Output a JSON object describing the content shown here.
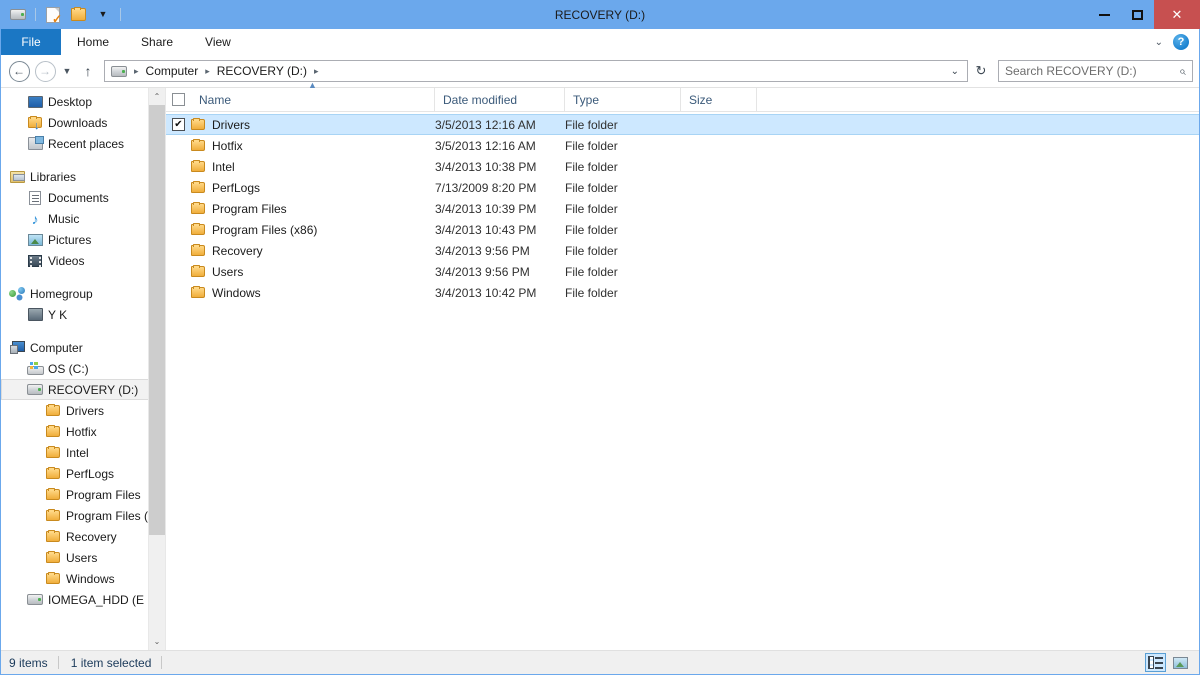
{
  "window": {
    "title": "RECOVERY (D:)",
    "controls": {
      "minimize": "—",
      "maximize": "□",
      "close": "✕"
    },
    "close_color": "#c75050",
    "titlebar_color": "#6ba8ec"
  },
  "quick_access": {
    "items": [
      {
        "name": "drive-icon",
        "label": ""
      },
      {
        "name": "properties-icon",
        "label": ""
      },
      {
        "name": "new-folder-icon",
        "label": ""
      }
    ],
    "dropdown_glyph": "▼"
  },
  "ribbon": {
    "file_tab": "File",
    "tabs": [
      "Home",
      "Share",
      "View"
    ],
    "expand_glyph": "⌄",
    "help_glyph": "?",
    "file_tab_color": "#1b77c4"
  },
  "address_bar": {
    "back_glyph": "←",
    "forward_glyph": "→",
    "recent_glyph": "▼",
    "up_glyph": "↑",
    "breadcrumbs": [
      "Computer",
      "RECOVERY (D:)"
    ],
    "separator": "▸",
    "dropdown_glyph": "⌄",
    "refresh_glyph": "↻"
  },
  "search": {
    "placeholder": "Search RECOVERY (D:)",
    "icon_glyph": "⌕"
  },
  "sidebar": {
    "items": [
      {
        "label": "Desktop",
        "icon": "desktop-icon",
        "indent": 1
      },
      {
        "label": "Downloads",
        "icon": "downloads-folder-icon",
        "indent": 1
      },
      {
        "label": "Recent places",
        "icon": "recent-places-icon",
        "indent": 1
      },
      {
        "label": "Libraries",
        "icon": "libraries-icon",
        "indent": 0
      },
      {
        "label": "Documents",
        "icon": "documents-icon",
        "indent": 1
      },
      {
        "label": "Music",
        "icon": "music-icon",
        "indent": 1
      },
      {
        "label": "Pictures",
        "icon": "pictures-icon",
        "indent": 1
      },
      {
        "label": "Videos",
        "icon": "videos-icon",
        "indent": 1
      },
      {
        "label": "Homegroup",
        "icon": "homegroup-icon",
        "indent": 0
      },
      {
        "label": "Y K",
        "icon": "user-icon",
        "indent": 1
      },
      {
        "label": "Computer",
        "icon": "computer-icon",
        "indent": 0
      },
      {
        "label": "OS (C:)",
        "icon": "os-drive-icon",
        "indent": 1
      },
      {
        "label": "RECOVERY (D:)",
        "icon": "drive-icon",
        "indent": 1,
        "selected": true
      },
      {
        "label": "Drivers",
        "icon": "folder-icon",
        "indent": 2
      },
      {
        "label": "Hotfix",
        "icon": "folder-icon",
        "indent": 2
      },
      {
        "label": "Intel",
        "icon": "folder-icon",
        "indent": 2
      },
      {
        "label": "PerfLogs",
        "icon": "folder-icon",
        "indent": 2
      },
      {
        "label": "Program Files",
        "icon": "folder-icon",
        "indent": 2
      },
      {
        "label": "Program Files (",
        "icon": "folder-icon",
        "indent": 2
      },
      {
        "label": "Recovery",
        "icon": "folder-icon",
        "indent": 2
      },
      {
        "label": "Users",
        "icon": "folder-icon",
        "indent": 2
      },
      {
        "label": "Windows",
        "icon": "folder-icon",
        "indent": 2
      },
      {
        "label": "IOMEGA_HDD (E",
        "icon": "drive-icon",
        "indent": 1
      }
    ],
    "scroll_up_glyph": "⌃",
    "scroll_down_glyph": "⌄"
  },
  "file_list": {
    "columns": [
      {
        "key": "name",
        "label": "Name",
        "sorted": "asc"
      },
      {
        "key": "date",
        "label": "Date modified"
      },
      {
        "key": "type",
        "label": "Type"
      },
      {
        "key": "size",
        "label": "Size"
      }
    ],
    "sort_arrow_glyph": "▲",
    "check_glyph": "✔",
    "rows": [
      {
        "name": "Drivers",
        "date": "3/5/2013 12:16 AM",
        "type": "File folder",
        "size": "",
        "selected": true,
        "checked": true
      },
      {
        "name": "Hotfix",
        "date": "3/5/2013 12:16 AM",
        "type": "File folder",
        "size": "",
        "selected": false,
        "checked": false
      },
      {
        "name": "Intel",
        "date": "3/4/2013 10:38 PM",
        "type": "File folder",
        "size": "",
        "selected": false,
        "checked": false
      },
      {
        "name": "PerfLogs",
        "date": "7/13/2009 8:20 PM",
        "type": "File folder",
        "size": "",
        "selected": false,
        "checked": false
      },
      {
        "name": "Program Files",
        "date": "3/4/2013 10:39 PM",
        "type": "File folder",
        "size": "",
        "selected": false,
        "checked": false
      },
      {
        "name": "Program Files (x86)",
        "date": "3/4/2013 10:43 PM",
        "type": "File folder",
        "size": "",
        "selected": false,
        "checked": false
      },
      {
        "name": "Recovery",
        "date": "3/4/2013 9:56 PM",
        "type": "File folder",
        "size": "",
        "selected": false,
        "checked": false
      },
      {
        "name": "Users",
        "date": "3/4/2013 9:56 PM",
        "type": "File folder",
        "size": "",
        "selected": false,
        "checked": false
      },
      {
        "name": "Windows",
        "date": "3/4/2013 10:42 PM",
        "type": "File folder",
        "size": "",
        "selected": false,
        "checked": false
      }
    ]
  },
  "status_bar": {
    "item_count": "9 items",
    "selection": "1 item selected",
    "view_details": "details-view",
    "view_thumbnails": "thumbnails-view",
    "active_view": "details"
  },
  "colors": {
    "selection_blue": "#cde8ff",
    "accent": "#1b77c4",
    "chrome": "#6ba8ec"
  }
}
